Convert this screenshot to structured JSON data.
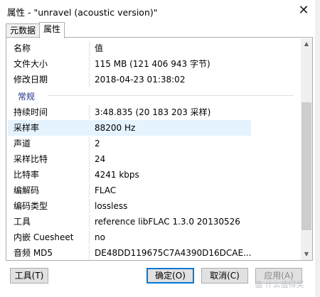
{
  "window": {
    "title": "属性 - \"unravel (acoustic version)\"",
    "close_glyph": "✕"
  },
  "tabs": [
    {
      "label": "元数据"
    },
    {
      "label": "属性"
    }
  ],
  "table": {
    "header": {
      "name": "名称",
      "value": "值"
    },
    "file_rows": [
      {
        "name": "文件大小",
        "value": "115 MB (121 406 943 字节)"
      },
      {
        "name": "修改日期",
        "value": "2018-04-23 01:38:02"
      }
    ],
    "group_label": "常规",
    "general_rows": [
      {
        "name": "持续时间",
        "value": "3:48.835 (20 183 203 采样)"
      },
      {
        "name": "采样率",
        "value": "88200 Hz"
      },
      {
        "name": "声道",
        "value": "2"
      },
      {
        "name": "采样比特",
        "value": "24"
      },
      {
        "name": "比特率",
        "value": "4241 kbps"
      },
      {
        "name": "编解码",
        "value": "FLAC"
      },
      {
        "name": "编码类型",
        "value": "lossless"
      },
      {
        "name": "工具",
        "value": "reference libFLAC 1.3.0 20130526"
      },
      {
        "name": "内嵌 Cuesheet",
        "value": "no"
      },
      {
        "name": "音频 MD5",
        "value": "DE48DD119675C7A4390D16DCAE..."
      }
    ]
  },
  "buttons": {
    "tools": "工具(T)",
    "ok": "确定(O)",
    "cancel": "取消(C)",
    "apply": "应用(A)"
  },
  "watermark": "值 什么值得买",
  "colors": {
    "selected_row": "#e5f3ff",
    "focus_border": "#0078d7",
    "group_label": "#1e3287"
  }
}
